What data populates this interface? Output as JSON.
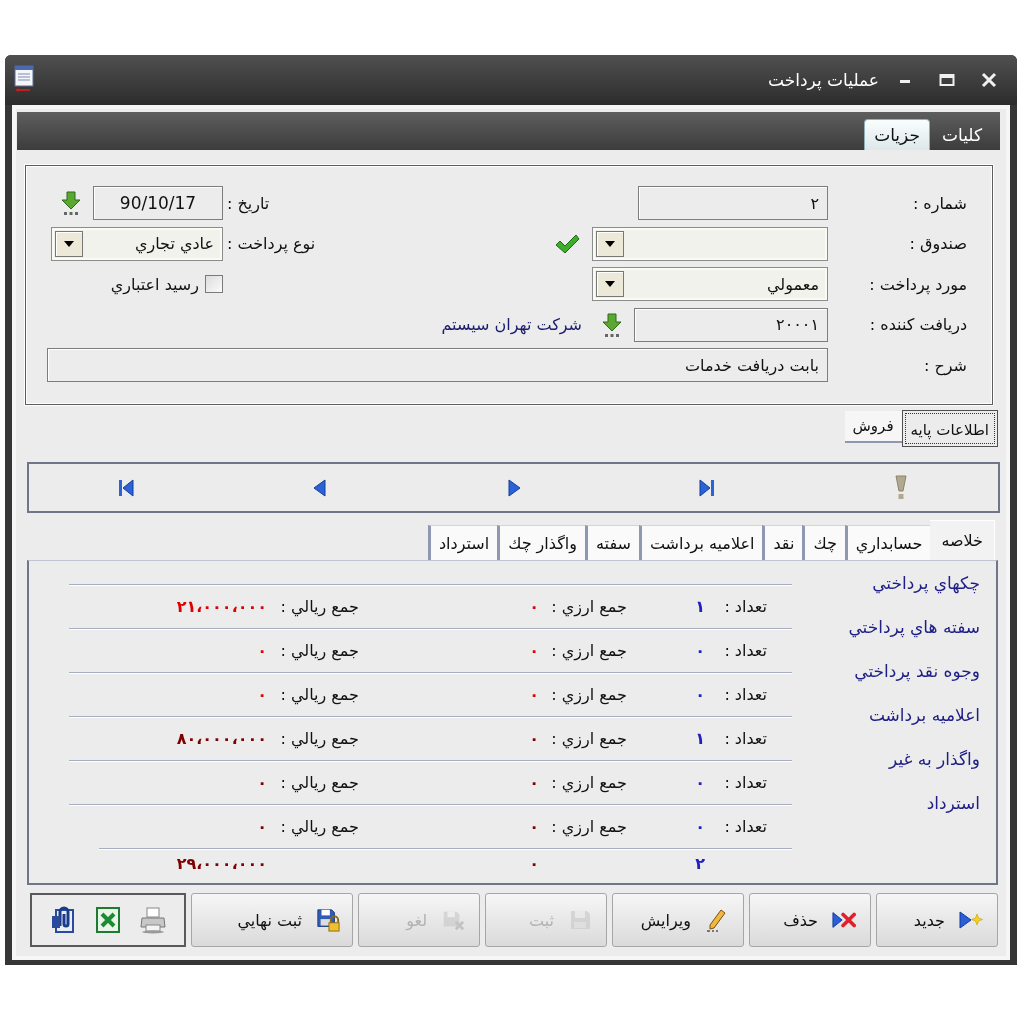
{
  "window": {
    "title": "عملیات پرداخت"
  },
  "top_tabs": [
    {
      "label": "کلیات",
      "selected": false
    },
    {
      "label": "جزیات",
      "selected": true
    }
  ],
  "form": {
    "number": {
      "label": "شماره :",
      "value": "۲"
    },
    "fund": {
      "label": "صندوق :"
    },
    "payment_item": {
      "label": "مورد پرداخت :",
      "value": "معمولي"
    },
    "receiver": {
      "label": "دریافت کننده :",
      "value": "۲۰۰۰۱",
      "name": "شرکت تهران سیستم"
    },
    "description": {
      "label": "شرح :",
      "value": "بابت دریافت خدمات"
    },
    "date": {
      "label": "تاریخ :",
      "value": "90/10/17"
    },
    "payment_type": {
      "label": "نوع پرداخت :",
      "value": "عادي تجاري"
    },
    "credit_receipt": {
      "label": "رسيد اعتباري",
      "checked": false
    }
  },
  "sub_tabs": [
    {
      "label": "اطلاعات پایه",
      "selected": true
    },
    {
      "label": "فروش",
      "selected": false
    }
  ],
  "detail_tabs": [
    {
      "label": "خلاصه",
      "selected": true
    },
    {
      "label": "حسابداري",
      "selected": false
    },
    {
      "label": "چك",
      "selected": false
    },
    {
      "label": "نقد",
      "selected": false
    },
    {
      "label": "اعلاميه برداشت",
      "selected": false
    },
    {
      "label": "سفته",
      "selected": false
    },
    {
      "label": "واگذار چك",
      "selected": false
    },
    {
      "label": "استرداد",
      "selected": false
    }
  ],
  "summary": {
    "rows": [
      {
        "label": "چكهاي پرداختي",
        "count_label": "تعداد :",
        "count": "۱",
        "currency_label": "جمع ارزي :",
        "currency": "۰",
        "rial_label": "جمع ريالي :",
        "rial": "۲۱،۰۰۰،۰۰۰",
        "color": "#e00000"
      },
      {
        "label": "سفته هاي پرداختي",
        "count_label": "تعداد :",
        "count": "۰",
        "currency_label": "جمع ارزي :",
        "currency": "۰",
        "rial_label": "جمع ريالي :",
        "rial": "۰",
        "color": "#e00000"
      },
      {
        "label": "وجوه نقد پرداختي",
        "count_label": "تعداد :",
        "count": "۰",
        "currency_label": "جمع ارزي :",
        "currency": "۰",
        "rial_label": "جمع ريالي :",
        "rial": "۰",
        "color": "#e00000"
      },
      {
        "label": "اعلاميه برداشت",
        "count_label": "تعداد :",
        "count": "۱",
        "currency_label": "جمع ارزي :",
        "currency": "۰",
        "rial_label": "جمع ريالي :",
        "rial": "۸۰،۰۰۰،۰۰۰",
        "color": "#800000"
      },
      {
        "label": "واگذار به غير",
        "count_label": "تعداد :",
        "count": "۰",
        "currency_label": "جمع ارزي :",
        "currency": "۰",
        "rial_label": "جمع ريالي :",
        "rial": "۰",
        "color": "#800000"
      },
      {
        "label": "استرداد",
        "count_label": "تعداد :",
        "count": "۰",
        "currency_label": "جمع ارزي :",
        "currency": "۰",
        "rial_label": "جمع ريالي :",
        "rial": "۰",
        "color": "#800000"
      }
    ],
    "totals": {
      "count": "۲",
      "currency": "۰",
      "rial": "۲۹،۰۰۰،۰۰۰",
      "color": "#800000"
    }
  },
  "toolbar": {
    "buttons": [
      {
        "label": "جدید",
        "disabled": false
      },
      {
        "label": "حذف",
        "disabled": false
      },
      {
        "label": "ویرایش",
        "disabled": false
      },
      {
        "label": "ثبت",
        "disabled": true
      },
      {
        "label": "لغو",
        "disabled": true
      },
      {
        "label": "ثبت نهايي",
        "disabled": false
      }
    ]
  }
}
